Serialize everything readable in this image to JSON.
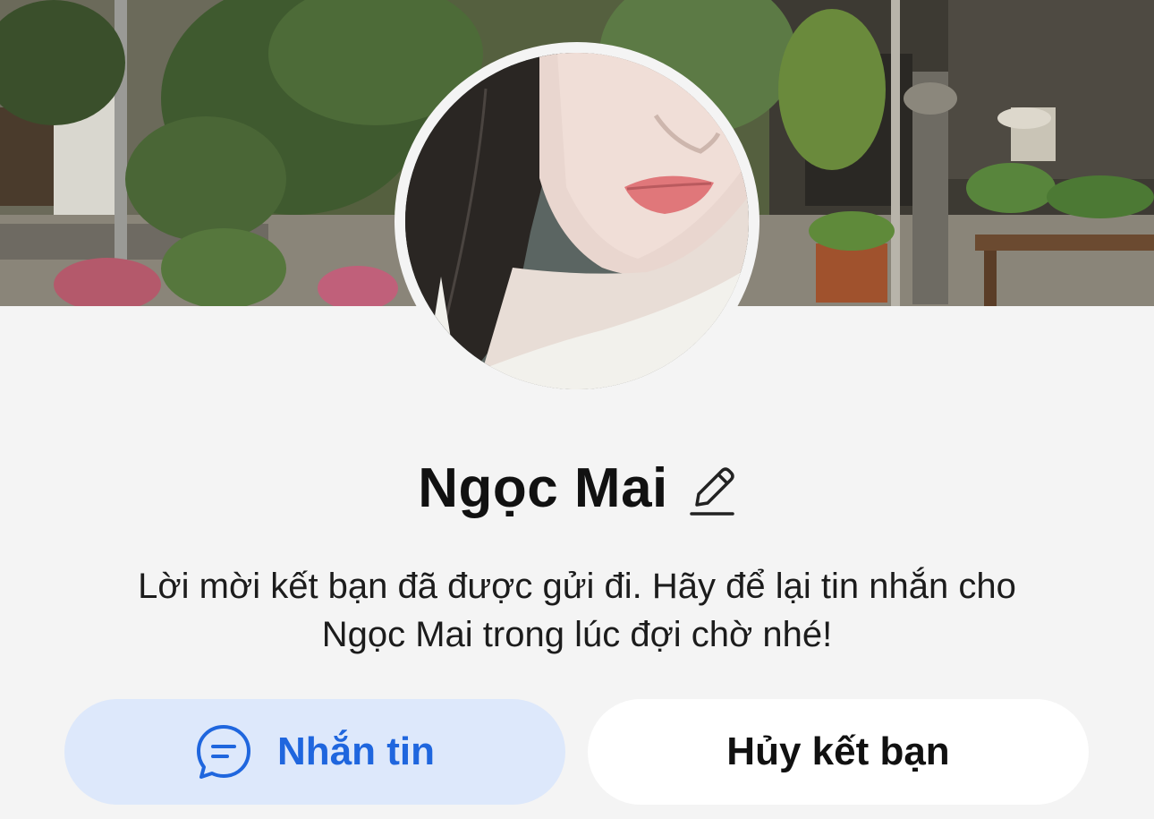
{
  "profile": {
    "name": "Ngọc Mai",
    "message_line1": "Lời mời kết bạn đã được gửi đi. Hãy để lại tin nhắn cho",
    "message_line2": "Ngọc Mai trong lúc đợi chờ nhé!"
  },
  "actions": {
    "message_label": "Nhắn tin",
    "cancel_label": "Hủy kết bạn"
  },
  "icons": {
    "edit": "pencil-icon",
    "chat": "chat-bubble-icon"
  },
  "colors": {
    "background": "#f4f4f4",
    "primary_button_bg": "#dde8fb",
    "primary_button_text": "#1f66de",
    "secondary_button_bg": "#ffffff",
    "text": "#111111"
  }
}
